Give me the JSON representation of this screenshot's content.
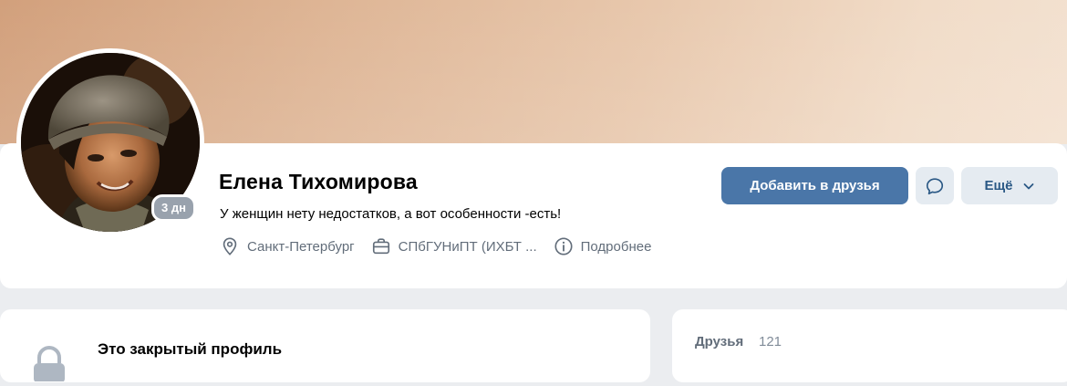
{
  "profile": {
    "name": "Елена Тихомирова",
    "status": "У женщин нету недостатков, а вот особенности -есть!",
    "online_badge": "3 дн",
    "info": {
      "city": "Санкт-Петербург",
      "education": "СПбГУНиПТ (ИХБТ ...",
      "more": "Подробнее"
    }
  },
  "actions": {
    "add_friend": "Добавить в друзья",
    "more": "Ещё"
  },
  "closed_profile": {
    "title": "Это закрытый профиль"
  },
  "friends": {
    "label": "Друзья",
    "count": "121"
  },
  "icons": {
    "location": "location-pin-icon",
    "work": "briefcase-icon",
    "info": "info-icon",
    "message": "message-bubble-icon",
    "chevron": "chevron-down-icon",
    "lock": "lock-icon"
  },
  "colors": {
    "primary_button": "#4a76a8",
    "secondary_button": "#e5ebf1",
    "link": "#2a5885",
    "muted_text": "#626d7a",
    "background": "#ebedf0"
  }
}
